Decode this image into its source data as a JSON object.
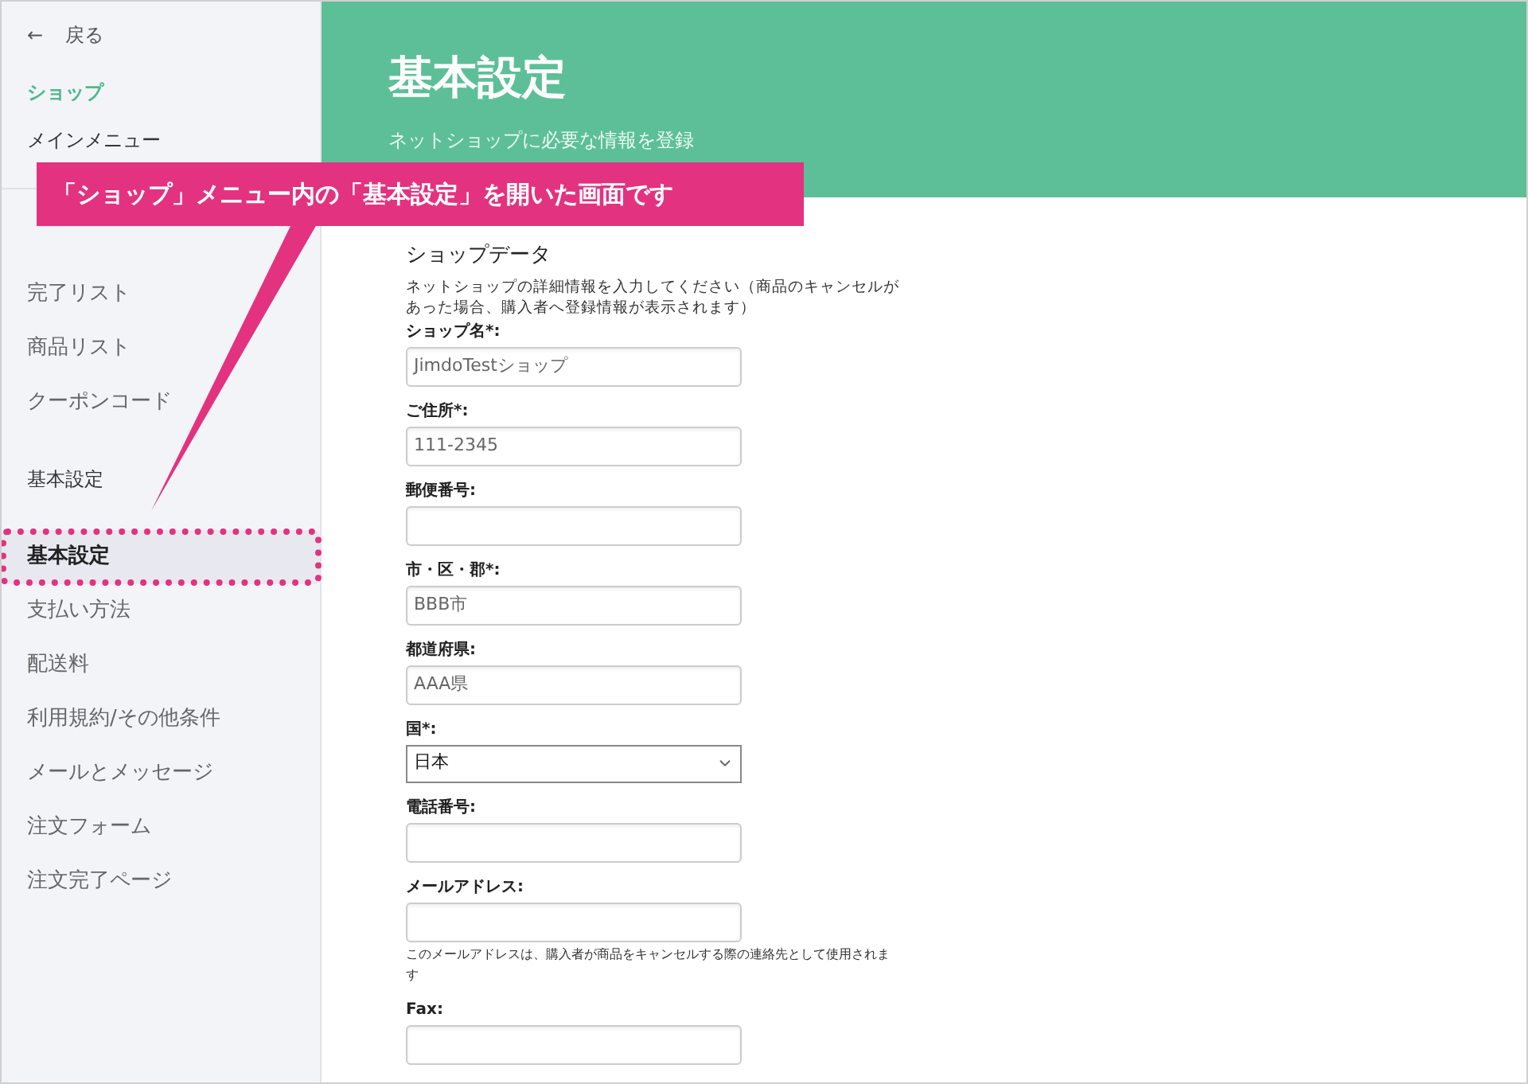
{
  "sidebar": {
    "back": {
      "icon": "←",
      "label": "戻る"
    },
    "section_title": "ショップ",
    "groups": [
      {
        "heading": "メインメニュー",
        "items": [
          {
            "label": "完了リスト",
            "selected": false
          },
          {
            "label": "商品リスト",
            "selected": false
          },
          {
            "label": "クーポンコード",
            "selected": false
          }
        ]
      },
      {
        "heading": "基本設定",
        "items": [
          {
            "label": "基本設定",
            "selected": true
          },
          {
            "label": "支払い方法",
            "selected": false
          },
          {
            "label": "配送料",
            "selected": false
          },
          {
            "label": "利用規約/その他条件",
            "selected": false
          },
          {
            "label": "メールとメッセージ",
            "selected": false
          },
          {
            "label": "注文フォーム",
            "selected": false
          },
          {
            "label": "注文完了ページ",
            "selected": false
          }
        ]
      }
    ]
  },
  "header": {
    "title": "基本設定",
    "subtitle": "ネットショップに必要な情報を登録"
  },
  "callout": "「ショップ」メニュー内の「基本設定」を開いた画面です",
  "form": {
    "title": "ショップデータ",
    "description": "ネットショップの詳細情報を入力してください（商品のキャンセルがあった場合、購入者へ登録情報が表示されます）",
    "fields": [
      {
        "kind": "text",
        "label": "ショップ名*:",
        "value": "JimdoTestショップ"
      },
      {
        "kind": "text",
        "label": "ご住所*:",
        "value": "111-2345"
      },
      {
        "kind": "text",
        "label": "郵便番号:"
      },
      {
        "kind": "text",
        "label": "市・区・郡*:",
        "value": "BBB市"
      },
      {
        "kind": "text",
        "label": "都道府県:",
        "value": "AAA県"
      },
      {
        "kind": "select",
        "label": "国*:",
        "value": "日本"
      },
      {
        "kind": "text",
        "label": "電話番号:"
      },
      {
        "kind": "text",
        "label": "メールアドレス:",
        "hint": "このメールアドレスは、購入者が商品をキャンセルする際の連絡先として使用されます"
      },
      {
        "kind": "text",
        "label": "Fax:"
      }
    ]
  }
}
